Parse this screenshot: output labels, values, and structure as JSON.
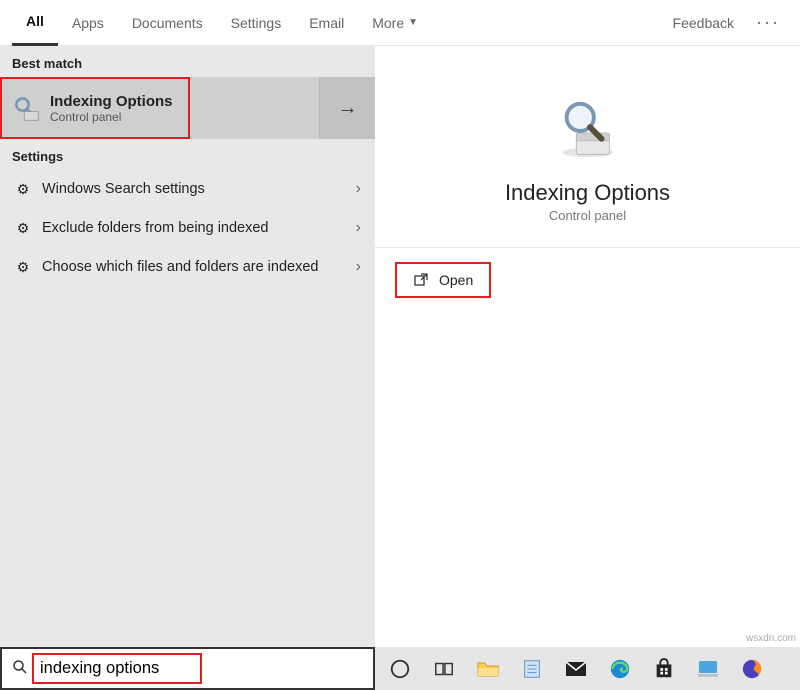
{
  "tabs": {
    "items": [
      "All",
      "Apps",
      "Documents",
      "Settings",
      "Email",
      "More"
    ],
    "active_index": 0,
    "feedback": "Feedback"
  },
  "left": {
    "best_match_header": "Best match",
    "best_match": {
      "title": "Indexing Options",
      "subtitle": "Control panel",
      "icon": "magnifier-folder-icon"
    },
    "settings_header": "Settings",
    "settings": [
      {
        "label": "Windows Search settings"
      },
      {
        "label": "Exclude folders from being indexed"
      },
      {
        "label": "Choose which files and folders are indexed"
      }
    ]
  },
  "right": {
    "title": "Indexing Options",
    "subtitle": "Control panel",
    "open_label": "Open",
    "icon": "magnifier-folder-icon"
  },
  "search": {
    "value": "indexing options",
    "icon": "search-icon"
  },
  "taskbar": {
    "icons": [
      "cortana-circle-icon",
      "task-view-icon",
      "file-explorer-icon",
      "notepad-icon",
      "mail-icon",
      "edge-icon",
      "store-icon",
      "surface-icon",
      "firefox-icon"
    ]
  },
  "watermark": "wsxdn.com",
  "colors": {
    "highlight": "#e02020",
    "panel_bg": "#e8e8e8",
    "selected_bg": "#cfcfcf"
  }
}
